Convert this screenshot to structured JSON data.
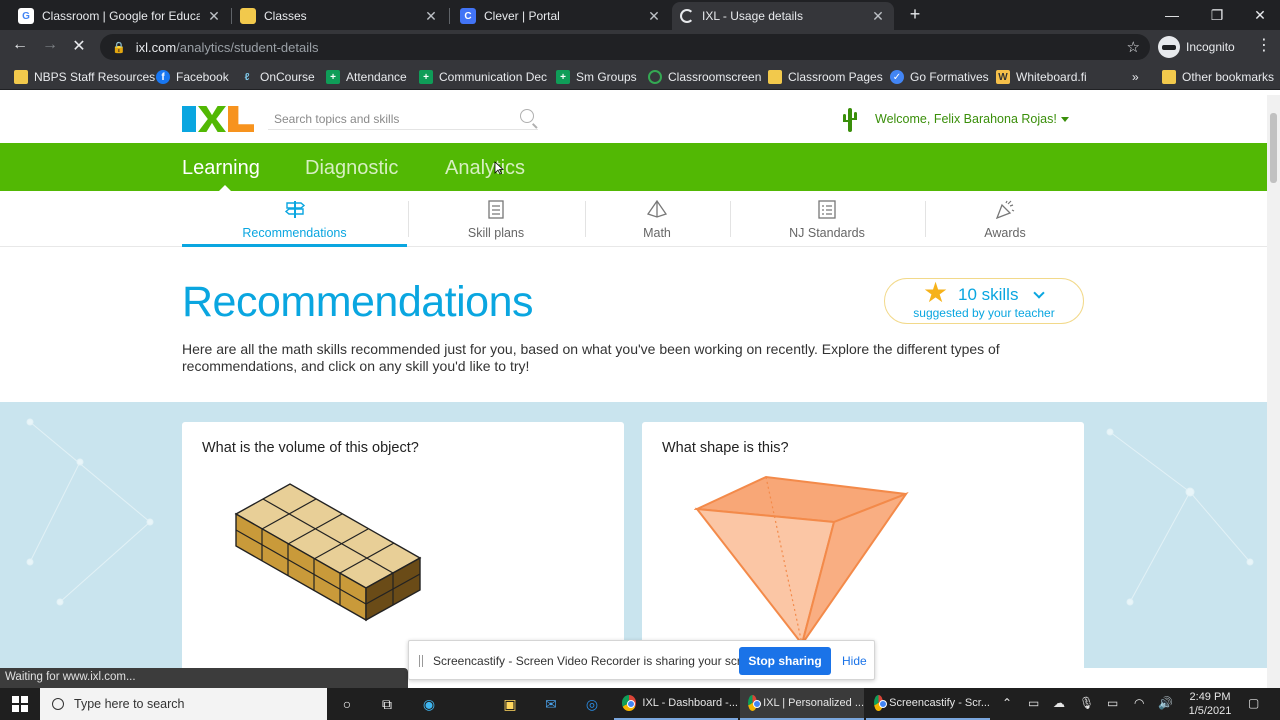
{
  "browser": {
    "tabs": [
      {
        "title": "Classroom | Google for Education",
        "favicon": "google-icon",
        "color": "#ffffff"
      },
      {
        "title": "Classes",
        "favicon": "classroom-icon",
        "color": "#f2c94c"
      },
      {
        "title": "Clever | Portal",
        "favicon": "clever-icon",
        "color": "#4274f6"
      },
      {
        "title": "IXL - Usage details",
        "favicon": "loading-icon",
        "color": "#e8eaed"
      }
    ],
    "url_host": "ixl.com",
    "url_path": "/analytics/student-details",
    "profile": "Incognito",
    "bookmarks": [
      "NBPS Staff Resources",
      "Facebook",
      "OnCourse",
      "Attendance",
      "Communication Dec",
      "Sm Groups",
      "Classroomscreen",
      "Classroom Pages",
      "Go Formatives",
      "Whiteboard.fi"
    ],
    "other_bookmarks": "Other bookmarks",
    "overflow": "»"
  },
  "ixl": {
    "search_placeholder": "Search topics and skills",
    "welcome": "Welcome, Felix Barahona Rojas!",
    "nav": [
      "Learning",
      "Diagnostic",
      "Analytics"
    ],
    "subnav": [
      "Recommendations",
      "Skill plans",
      "Math",
      "NJ Standards",
      "Awards"
    ],
    "heading": "Recommendations",
    "skills_count": "10 skills",
    "skills_sub": "suggested by your teacher",
    "intro": "Here are all the math skills recommended just for you, based on what you've been working on recently. Explore the different types of recommendations, and click on any skill you'd like to try!",
    "cards": [
      {
        "question": "What is the volume of this object?"
      },
      {
        "question": "What shape is this?"
      }
    ],
    "brand_colors": {
      "green": "#52b804",
      "blue": "#0aa6e0",
      "orange": "#f7931e",
      "star": "#f6b21a"
    }
  },
  "screencastify": {
    "message": "Screencastify - Screen Video Recorder is sharing your screen.",
    "stop": "Stop sharing",
    "hide": "Hide"
  },
  "status_text": "Waiting for www.ixl.com...",
  "taskbar": {
    "search_placeholder": "Type here to search",
    "apps": [
      "IXL - Dashboard -...",
      "IXL | Personalized ...",
      "Screencastify - Scr..."
    ],
    "time": "2:49 PM",
    "date": "1/5/2021"
  }
}
